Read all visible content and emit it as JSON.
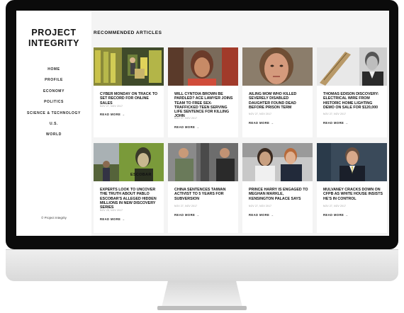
{
  "site": {
    "logo_line1": "PROJECT",
    "logo_line2": "INTEGRITY",
    "copyright": "© Project Integrity"
  },
  "nav": [
    "HOME",
    "PROFILE",
    "ECONOMY",
    "POLITICS",
    "SCIENCE & TECHNOLOGY",
    "U.S.",
    "WORLD"
  ],
  "section_title": "RECOMMENDED ARTICLES",
  "read_more": "READ MORE →",
  "articles": [
    {
      "title": "CYBER MONDAY ON TRACK TO SET RECORD FOR ONLINE SALES",
      "date": "NOV 27, NOV 2017"
    },
    {
      "title": "WILL CYNTOIA BROWN BE PARDLED? ACE LAWYER JOINS TEAM TO FREE SEX-TRAFFICKED TEEN SERVING LIFE SENTENCE FOR KILLING JOHN",
      "date": "NOV 27, NOV 2017"
    },
    {
      "title": "AILING MOM WHO KILLED SEVERELY DISABLED DAUGHTER FOUND DEAD BEFORE PRISON TERM",
      "date": "NOV 27, NOV 2017"
    },
    {
      "title": "THOMAS EDISON DISCOVERY: ELECTRICAL WIRE FROM HISTORIC HOME LIGHTING DEMO ON SALE FOR $120,000",
      "date": "NOV 27, NOV 2017"
    },
    {
      "title": "EXPERTS LOOK TO UNCOVER THE TRUTH ABOUT PABLO ESCOBAR'S ALLEGED HIDDEN MILLIONS IN NEW DISCOVERY SERIES",
      "date": "NOV 28, NOV 2017"
    },
    {
      "title": "CHINA SENTENCES TAIWAN ACTIVIST TO 5 YEARS FOR SUBVERSION",
      "date": "NOV 27, NOV 2017"
    },
    {
      "title": "PRINCE HARRY IS ENGAGED TO MEGHAN MARKLE, KENSINGTON PALACE SAYS",
      "date": "NOV 27, NOV 2017"
    },
    {
      "title": "MULVANEY CRACKS DOWN ON CFPB AS WHITE HOUSE INSISTS HE'S IN CONTROL",
      "date": "NOV 27, NOV 2017"
    }
  ],
  "image_labels": {
    "escobar_sign": "ESCOBAR"
  }
}
